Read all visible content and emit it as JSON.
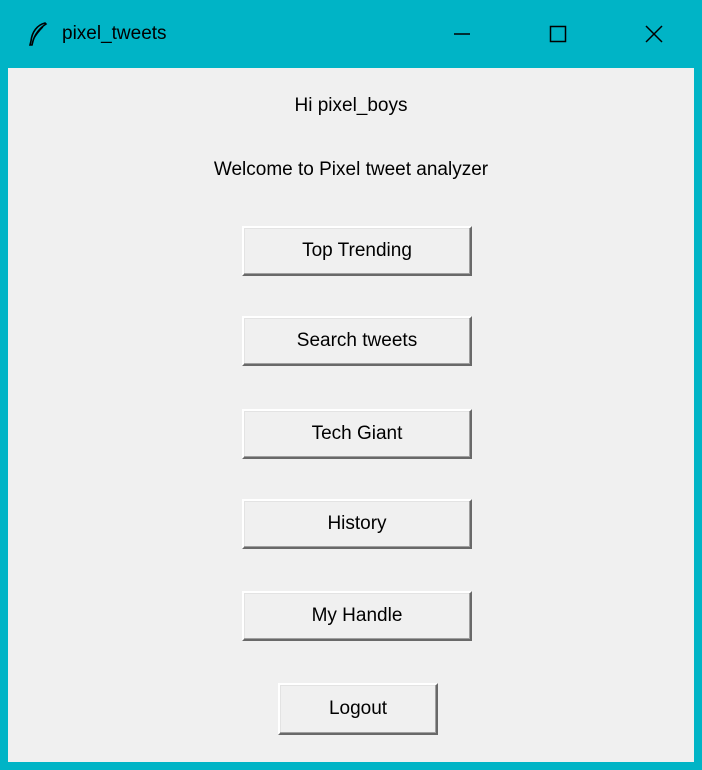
{
  "window": {
    "title": "pixel_tweets",
    "icon": "feather-icon",
    "controls": [
      "minimize-icon",
      "maximize-icon",
      "close-icon"
    ],
    "accent_color": "#00b4c6",
    "background_color": "#f0f0f0"
  },
  "content": {
    "greeting": "Hi pixel_boys",
    "welcome": "Welcome to Pixel tweet analyzer"
  },
  "buttons": {
    "top_trending": "Top Trending",
    "search_tweets": "Search tweets",
    "tech_giant": "Tech Giant",
    "history": "History",
    "my_handle": "My Handle",
    "logout": "Logout"
  }
}
